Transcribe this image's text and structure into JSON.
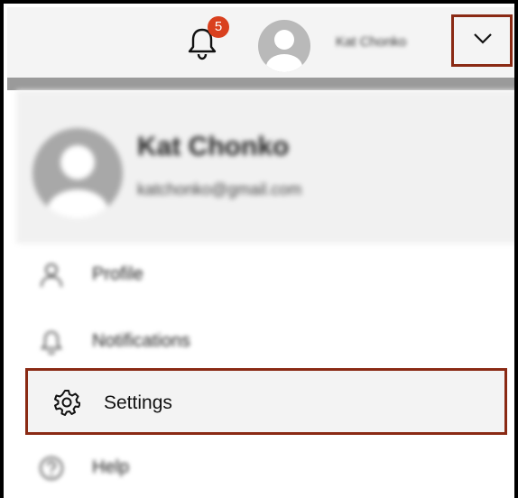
{
  "header": {
    "notification_count": "5",
    "username": "Kat Chonko",
    "accent_color": "#8a2a14",
    "badge_color": "#d9401e"
  },
  "profile_card": {
    "name": "Kat Chonko",
    "email": "katchonko@gmail.com"
  },
  "menu": {
    "items": [
      {
        "label": "Profile",
        "icon": "person-icon"
      },
      {
        "label": "Notifications",
        "icon": "bell-icon"
      },
      {
        "label": "Settings",
        "icon": "gear-icon"
      },
      {
        "label": "Help",
        "icon": "help-icon"
      }
    ]
  }
}
